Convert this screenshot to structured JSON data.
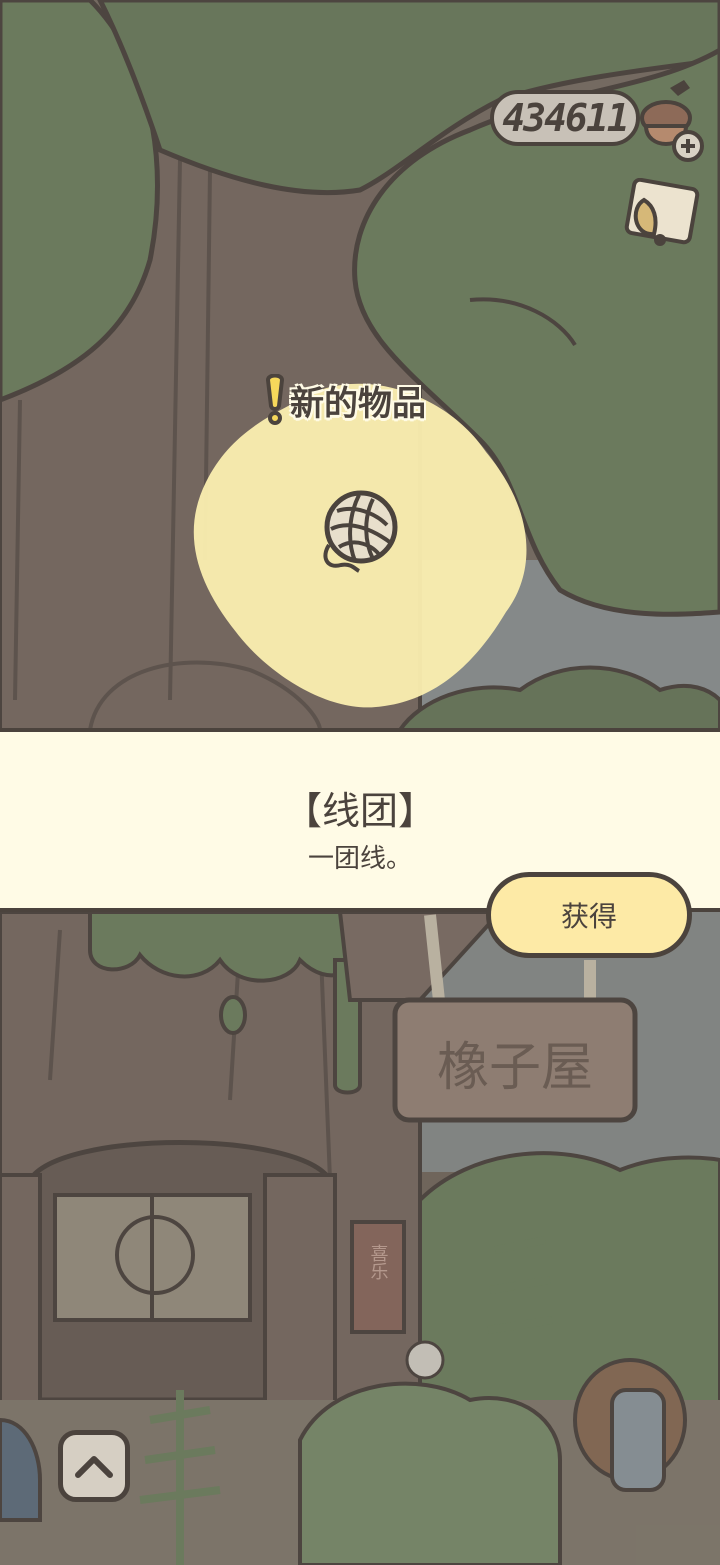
{
  "hud": {
    "currency_value": "434611",
    "currency_icon": "acorn-plus-icon",
    "ticket_icon": "ticket-icon"
  },
  "popup": {
    "label": "新的物品",
    "item_icon": "yarn-ball-icon",
    "item_name": "【线团】",
    "item_description": "一团线。",
    "get_button_label": "获得"
  },
  "scene": {
    "shop_sign": "橡子屋",
    "scroll_text": "喜乐"
  },
  "nav": {
    "up_button_icon": "chevron-up-icon"
  },
  "colors": {
    "outline": "#4b433d",
    "banner_bg": "#fffbe6",
    "highlight_blob": "#fbefb0",
    "button_bg": "#fdeaa6",
    "foliage": "#6f8361",
    "trunk": "#7c6e65"
  }
}
